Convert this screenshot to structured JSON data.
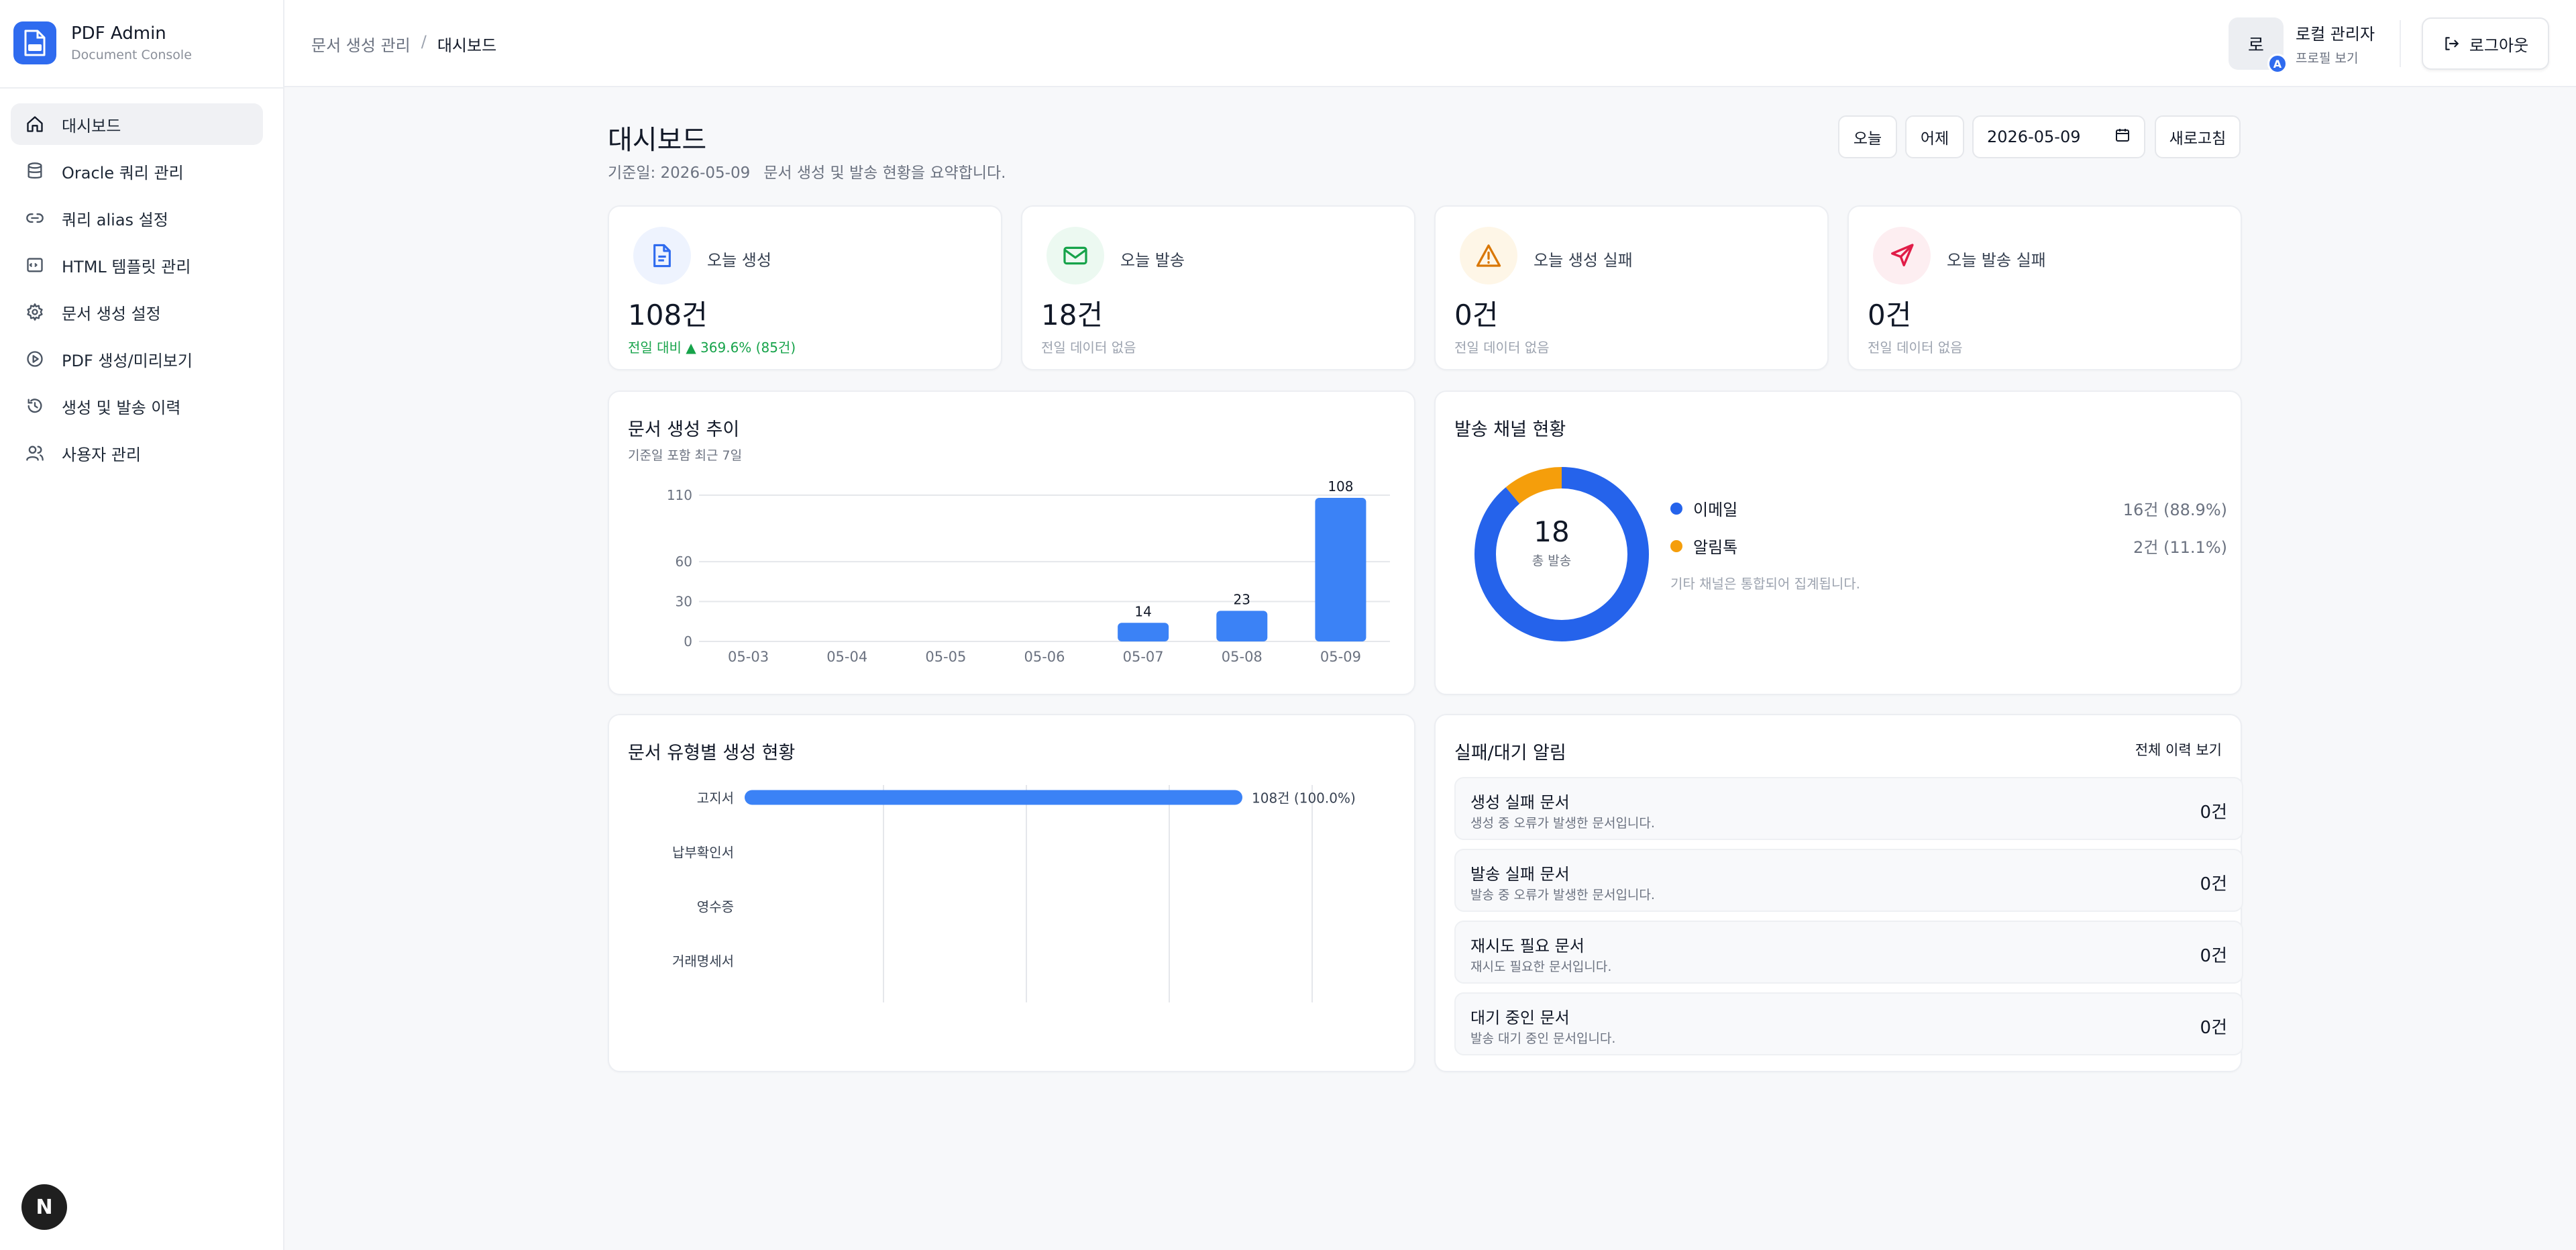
{
  "sidebar": {
    "brand_title": "PDF Admin",
    "brand_subtitle": "Document Console",
    "brand_icon": "pdf-document-icon",
    "items": [
      {
        "label": "대시보드",
        "icon": "home-icon",
        "active": true
      },
      {
        "label": "Oracle 쿼리 관리",
        "icon": "database-icon"
      },
      {
        "label": "쿼리 alias 설정",
        "icon": "link-icon"
      },
      {
        "label": "HTML 템플릿 관리",
        "icon": "template-icon"
      },
      {
        "label": "문서 생성 설정",
        "icon": "gear-icon"
      },
      {
        "label": "PDF 생성/미리보기",
        "icon": "play-icon"
      },
      {
        "label": "생성 및 발송 이력",
        "icon": "history-icon"
      },
      {
        "label": "사용자 관리",
        "icon": "users-icon"
      }
    ],
    "dev_badge": "N"
  },
  "header": {
    "breadcrumb_parent": "문서 생성 관리",
    "breadcrumb_sep": "/",
    "breadcrumb_current": "대시보드",
    "user_avatar": "로",
    "user_avatar_badge": "A",
    "user_name": "로컬 관리자",
    "user_profile_link": "프로필 보기",
    "logout_label": "로그아웃"
  },
  "page": {
    "title": "대시보드",
    "base_date_label": "기준일: 2026-05-09",
    "summary": "문서 생성 및 발송 현황을 요약합니다.",
    "btn_today": "오늘",
    "btn_yesterday": "어제",
    "date_value": "2026-05-09",
    "btn_refresh": "새로고침"
  },
  "kpis": [
    {
      "label": "오늘 생성",
      "value": "108건",
      "sub": "전일 대비 ▲ 369.6% (85건)",
      "icon": "document-icon",
      "color": "#2f6bef",
      "bg": "#eef3fe"
    },
    {
      "label": "오늘 발송",
      "value": "18건",
      "sub": "전일 데이터 없음",
      "icon": "mail-icon",
      "color": "#16a34a",
      "bg": "#ecf9f1"
    },
    {
      "label": "오늘 생성 실패",
      "value": "0건",
      "sub": "전일 데이터 없음",
      "icon": "warning-icon",
      "color": "#d97706",
      "bg": "#fef6e7"
    },
    {
      "label": "오늘 발송 실패",
      "value": "0건",
      "sub": "전일 데이터 없음",
      "icon": "send-icon",
      "color": "#e11d48",
      "bg": "#fdeef1"
    }
  ],
  "trend": {
    "title": "문서 생성 추이",
    "subtitle": "기준일 포함 최근 7일"
  },
  "channel": {
    "title": "발송 채널 현황",
    "total": "18",
    "total_label": "총 발송",
    "items": [
      {
        "name": "이메일",
        "value": "16건 (88.9%)",
        "color": "#2563eb"
      },
      {
        "name": "알림톡",
        "value": "2건 (11.1%)",
        "color": "#f59e0b"
      }
    ],
    "note": "기타 채널은 통합되어 집계됩니다."
  },
  "doctype": {
    "title": "문서 유형별 생성 현황"
  },
  "alerts": {
    "title": "실패/대기 알림",
    "link": "전체 이력 보기",
    "items": [
      {
        "title": "생성 실패 문서",
        "desc": "생성 중 오류가 발생한 문서입니다.",
        "count": "0건"
      },
      {
        "title": "발송 실패 문서",
        "desc": "발송 중 오류가 발생한 문서입니다.",
        "count": "0건"
      },
      {
        "title": "재시도 필요 문서",
        "desc": "재시도 필요한 문서입니다.",
        "count": "0건"
      },
      {
        "title": "대기 중인 문서",
        "desc": "발송 대기 중인 문서입니다.",
        "count": "0건"
      }
    ]
  },
  "chart_data": [
    {
      "type": "bar",
      "categories": [
        "05-03",
        "05-04",
        "05-05",
        "05-06",
        "05-07",
        "05-08",
        "05-09"
      ],
      "values": [
        0,
        0,
        0,
        0,
        14,
        23,
        108
      ],
      "yticks": [
        0,
        30,
        60,
        110
      ],
      "ylim": [
        0,
        110
      ],
      "grid": true,
      "color": "#3b82f6"
    },
    {
      "type": "pie",
      "categories": [
        "이메일",
        "알림톡"
      ],
      "values": [
        16,
        2
      ],
      "colors": [
        "#2563eb",
        "#f59e0b"
      ]
    },
    {
      "type": "bar",
      "orientation": "horizontal",
      "categories": [
        "고지서",
        "납부확인서",
        "영수증",
        "거래명세서"
      ],
      "values": [
        108,
        0,
        0,
        0
      ],
      "labels": [
        "108건 (100.0%)",
        "",
        "",
        ""
      ],
      "grid": true,
      "color": "#3b82f6"
    }
  ]
}
